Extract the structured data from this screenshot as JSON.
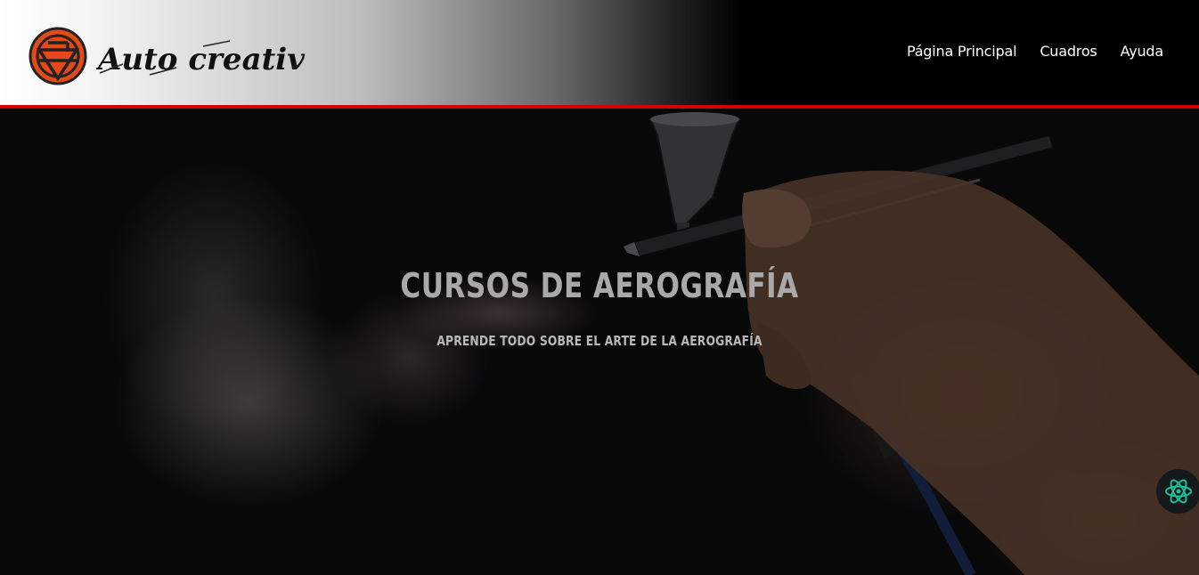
{
  "brand": {
    "name": "Auto creativo",
    "accent_color": "#d40000"
  },
  "nav": {
    "items": [
      {
        "label": "Página Principal"
      },
      {
        "label": "Cuadros"
      },
      {
        "label": "Ayuda"
      }
    ]
  },
  "hero": {
    "title": "CURSOS DE AEROGRAFÍA",
    "subtitle": "APRENDE TODO SOBRE EL ARTE DE LA AEROGRAFÍA"
  },
  "floating": {
    "icon": "atom-icon",
    "color": "#1fbf9a"
  }
}
